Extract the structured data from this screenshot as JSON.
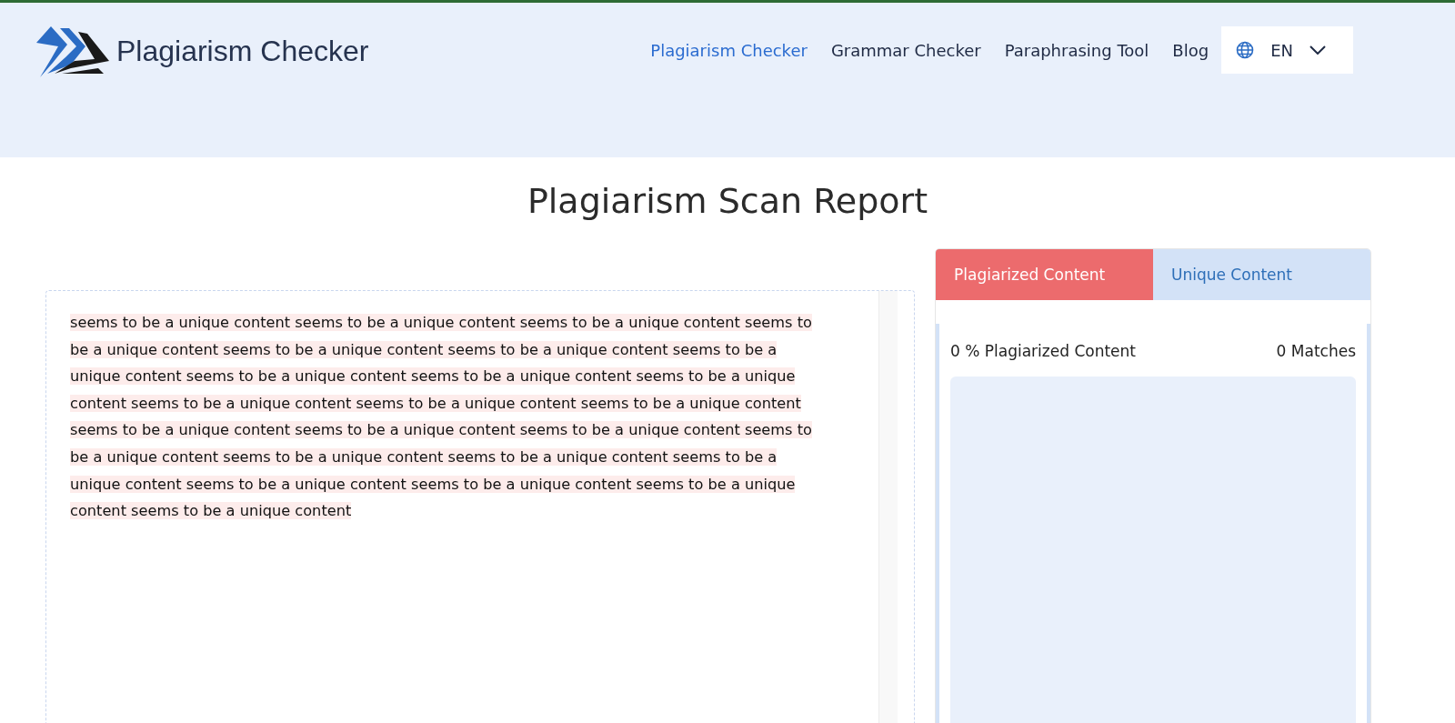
{
  "header": {
    "logo_text": "Plagiarism Checker",
    "nav": [
      {
        "label": "Plagiarism Checker",
        "selected": true
      },
      {
        "label": "Grammar Checker",
        "selected": false
      },
      {
        "label": "Paraphrasing Tool",
        "selected": false
      },
      {
        "label": "Blog",
        "selected": false
      }
    ],
    "language": "EN"
  },
  "title": "Plagiarism Scan Report",
  "document": {
    "text": " seems to be a unique content  seems to be a unique content  seems to be a unique content  seems to be a unique content  seems to be a unique content  seems to be a unique content  seems to be a unique content  seems to be a unique content  seems to be a unique content  seems to be a unique content  seems to be a unique content  seems to be a unique content  seems to be a unique content  seems to be a unique content  seems to be a unique content  seems to be a unique content  seems to be a unique content  seems to be a unique content  seems to be a unique content  seems to be a unique content  seems to be a unique content  seems to be a unique content  seems to be a unique content  seems to be a unique content "
  },
  "results": {
    "tabs": [
      {
        "label": "Plagiarized Content",
        "selected": true
      },
      {
        "label": "Unique Content",
        "selected": false
      }
    ],
    "summary": "0 % Plagiarized Content",
    "matches": "0 Matches"
  }
}
